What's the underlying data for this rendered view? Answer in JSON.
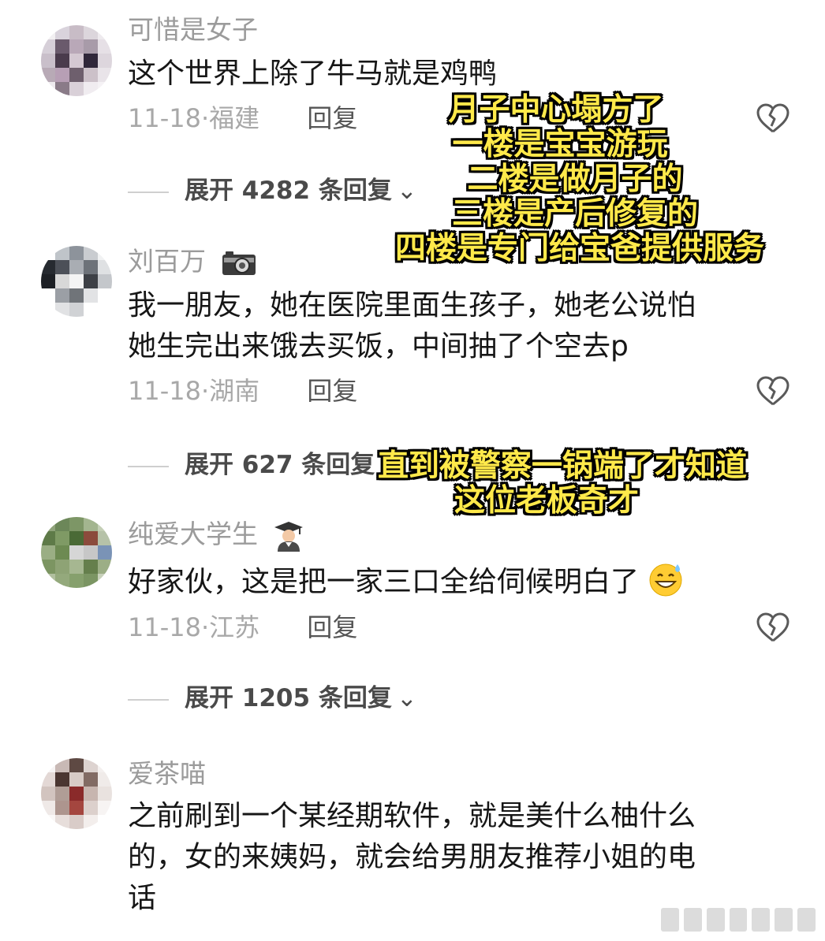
{
  "comments": [
    {
      "username": "可惜是女子",
      "content": "这个世界上除了牛马就是鸡鸭",
      "date": "11-18",
      "location": "福建",
      "reply_label": "回复",
      "expand_label": "展开 4282 条回复"
    },
    {
      "username": "刘百万",
      "badge_icon": "camera-icon",
      "content_lines": [
        "我一朋友，她在医院里面生孩子，她老公说怕",
        "她生完出来饿去买饭，中间抽了个空去p"
      ],
      "date": "11-18",
      "location": "湖南",
      "reply_label": "回复",
      "expand_label": "展开 627 条回复"
    },
    {
      "username": "纯爱大学生",
      "badge_icon": "graduate-emoji-icon",
      "content": "好家伙，这是把一家三口全给伺候明白了",
      "emoji_icon": "sweat-smile-emoji-icon",
      "date": "11-18",
      "location": "江苏",
      "reply_label": "回复",
      "expand_label": "展开 1205 条回复"
    },
    {
      "username": "爱茶喵",
      "content_lines": [
        "之前刷到一个某经期软件，就是美什么柚什么",
        "的，女的来姨妈，就会给男朋友推荐小姐的电",
        "话"
      ]
    }
  ],
  "overlay": {
    "block1": [
      "月子中心塌方了",
      "一楼是宝宝游玩",
      "二楼是做月子的",
      "三楼是产后修复的",
      "四楼是专门给宝爸提供服务"
    ],
    "block2": [
      "直到被警察一锅端了才知道",
      "这位老板奇才"
    ],
    "color": "#ffe94a"
  },
  "colors": {
    "username": "#9b9b9b",
    "content": "#161616",
    "meta": "#a8a8a8"
  }
}
